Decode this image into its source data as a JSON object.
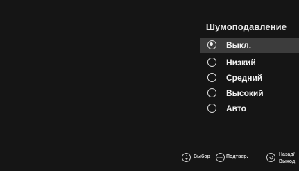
{
  "menu": {
    "title": "Шумоподавление",
    "options": [
      {
        "label": "Выкл.",
        "selected": true
      },
      {
        "label": "Низкий",
        "selected": false
      },
      {
        "label": "Средний",
        "selected": false
      },
      {
        "label": "Высокий",
        "selected": false
      },
      {
        "label": "Авто",
        "selected": false
      }
    ]
  },
  "footer": {
    "select_label": "Выбор",
    "select_icon": "up-down-nav-icon",
    "confirm_label": "Подтвер.",
    "confirm_icon": "enter-button-icon",
    "confirm_icon_text": "ENTER",
    "back_label_line1": "Назад/",
    "back_label_line2": "Выход",
    "back_icon": "return-button-icon"
  },
  "colors": {
    "background": "#151515",
    "highlight": "#3c3c3c",
    "text": "#f0f0f0"
  }
}
